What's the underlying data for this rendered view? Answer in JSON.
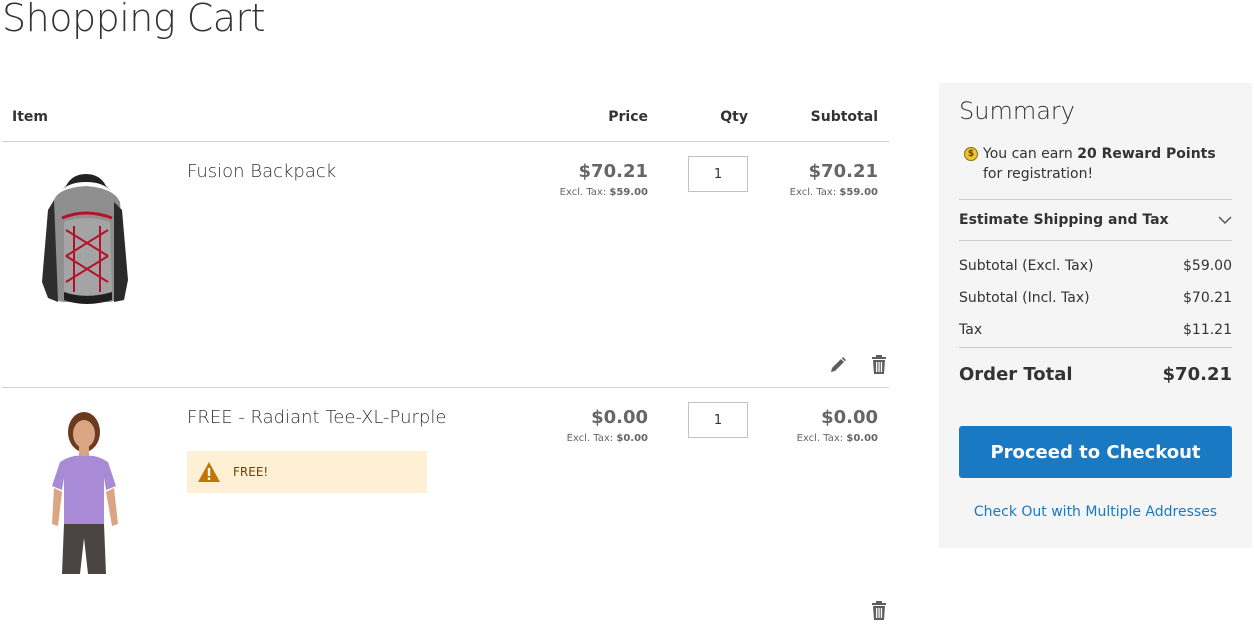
{
  "page": {
    "title": "Shopping Cart"
  },
  "cart": {
    "headers": {
      "item": "Item",
      "price": "Price",
      "qty": "Qty",
      "subtotal": "Subtotal"
    },
    "items": [
      {
        "name": "Fusion Backpack",
        "price": "$70.21",
        "price_excl_label": "Excl. Tax:",
        "price_excl": "$59.00",
        "qty": "1",
        "subtotal": "$70.21",
        "subtotal_excl_label": "Excl. Tax:",
        "subtotal_excl": "$59.00",
        "image_icon": "backpack-image"
      },
      {
        "name": "FREE - Radiant Tee-XL-Purple",
        "price": "$0.00",
        "price_excl_label": "Excl. Tax:",
        "price_excl": "$0.00",
        "qty": "1",
        "subtotal": "$0.00",
        "subtotal_excl_label": "Excl. Tax:",
        "subtotal_excl": "$0.00",
        "message": "FREE!",
        "image_icon": "tee-image"
      }
    ]
  },
  "summary": {
    "title": "Summary",
    "reward_prefix": "You can earn ",
    "reward_points": "20 Reward Points",
    "reward_suffix": " for registration!",
    "estimate_label": "Estimate Shipping and Tax",
    "rows": [
      {
        "label": "Subtotal (Excl. Tax)",
        "value": "$59.00"
      },
      {
        "label": "Subtotal (Incl. Tax)",
        "value": "$70.21"
      },
      {
        "label": "Tax",
        "value": "$11.21"
      }
    ],
    "order_total_label": "Order Total",
    "order_total_value": "$70.21",
    "checkout_label": "Proceed to Checkout",
    "multi_address_label": "Check Out with Multiple Addresses"
  },
  "colors": {
    "accent": "#1979c3",
    "summary_bg": "#f5f5f5",
    "message_bg": "#fdf0d5",
    "warning_icon": "#c07600"
  }
}
